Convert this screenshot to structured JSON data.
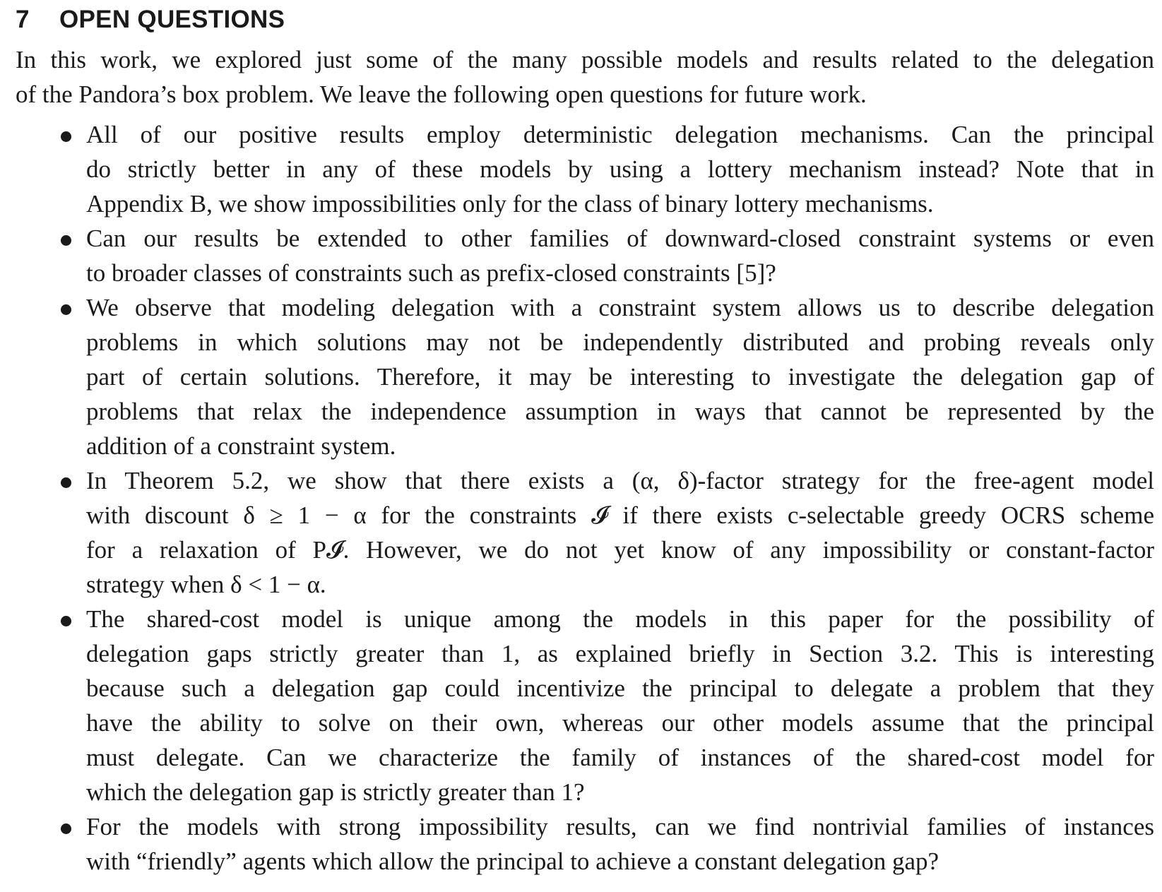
{
  "section": {
    "number": "7",
    "title": "OPEN QUESTIONS"
  },
  "intro_lines": [
    "In this work, we explored just some of the many possible models and results related to the delegation",
    "of the Pandora’s box problem. We leave the following open questions for future work."
  ],
  "bullets": [
    {
      "lines": [
        "All of our positive results employ deterministic delegation mechanisms. Can the principal",
        "do strictly better in any of these models by using a lottery mechanism instead? Note that in",
        "Appendix B, we show impossibilities only for the class of binary lottery mechanisms."
      ]
    },
    {
      "lines": [
        "Can our results be extended to other families of downward-closed constraint systems or even",
        "to broader classes of constraints such as prefix-closed constraints [5]?"
      ]
    },
    {
      "lines": [
        "We observe that modeling delegation with a constraint system allows us to describe delegation",
        "problems in which solutions may not be independently distributed and probing reveals only",
        "part of certain solutions. Therefore, it may be interesting to investigate the delegation gap of",
        "problems that relax the independence assumption in ways that cannot be represented by the",
        "addition of a constraint system."
      ]
    },
    {
      "lines": [
        "In Theorem 5.2, we show that there exists a (α, δ)-factor strategy for the free-agent model",
        "with discount δ ≥ 1 − α for the constraints 𝓘 if there exists c-selectable greedy OCRS scheme",
        "for a relaxation of P𝓘. However, we do not yet know of any impossibility or constant-factor",
        "strategy when δ < 1 − α."
      ]
    },
    {
      "lines": [
        "The shared-cost model is unique among the models in this paper for the possibility of",
        "delegation gaps strictly greater than 1, as explained briefly in Section 3.2. This is interesting",
        "because such a delegation gap could incentivize the principal to delegate a problem that they",
        "have the ability to solve on their own, whereas our other models assume that the principal",
        "must delegate. Can we characterize the family of instances of the shared-cost model for",
        "which the delegation gap is strictly greater than 1?"
      ]
    },
    {
      "lines": [
        "For the models with strong impossibility results, can we find nontrivial families of instances",
        "with “friendly” agents which allow the principal to achieve a constant delegation gap?"
      ]
    }
  ]
}
